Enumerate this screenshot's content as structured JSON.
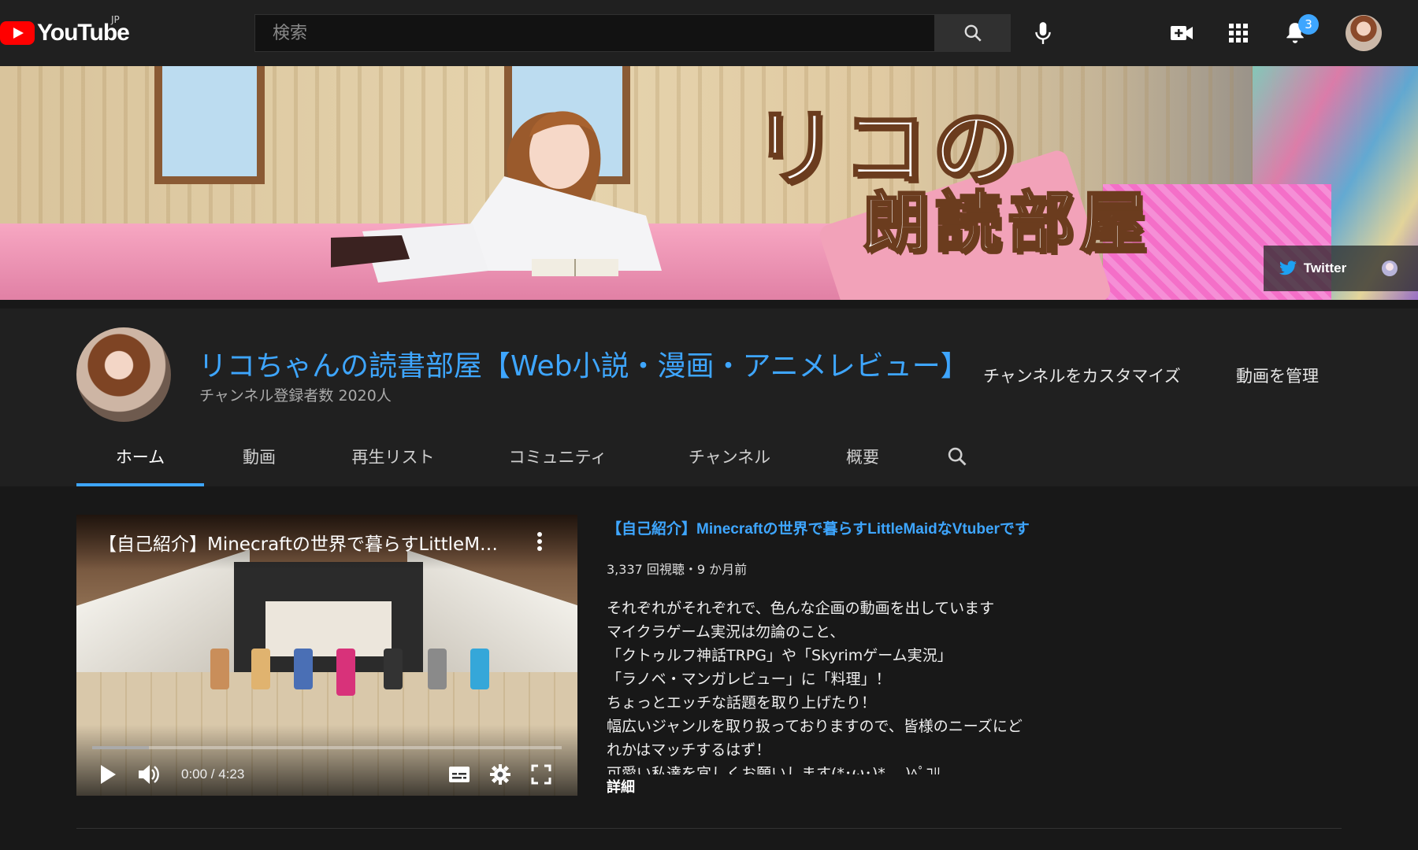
{
  "topbar": {
    "logo_text": "YouTube",
    "region": "JP",
    "search_placeholder": "検索",
    "notification_count": "3"
  },
  "banner": {
    "title_line1": "リコの",
    "title_line2": "朗読部屋",
    "twitter_label": "Twitter"
  },
  "channel": {
    "name": "リコちゃんの読書部屋【Web小説・漫画・アニメレビュー】",
    "subscribers": "チャンネル登録者数 2020人",
    "customize_label": "チャンネルをカスタマイズ",
    "manage_label": "動画を管理",
    "accent_color": "#3ea6ff"
  },
  "tabs": [
    {
      "label": "ホーム",
      "active": true
    },
    {
      "label": "動画"
    },
    {
      "label": "再生リスト"
    },
    {
      "label": "コミュニティ"
    },
    {
      "label": "チャンネル"
    },
    {
      "label": "概要"
    }
  ],
  "featured": {
    "player_title": "【自己紹介】Minecraftの世界で暮らすLittleMaidなVtuberです",
    "time": "0:00 / 4:23",
    "progress": 0.12,
    "title": "【自己紹介】Minecraftの世界で暮らすLittleMaidなVtuberです",
    "meta": "3,337 回視聴・9 か月前",
    "description": [
      "それぞれがそれぞれで、色んな企画の動画を出しています",
      "マイクラゲーム実況は勿論のこと、",
      "「クトゥルフ神話TRPG」や「Skyrimゲーム実況」",
      "「ラノベ・マンガレビュー」に「料理」！",
      "ちょっとエッチな話題を取り上げたり！",
      "幅広いジャンルを取り扱っておりますので、皆様のニーズにど",
      "れかはマッチするはず！",
      "可愛い私達を宜しくお願いします(*･ω･)*_ _)ﾍﾟｺﾘ"
    ],
    "more_label": "詳細"
  }
}
